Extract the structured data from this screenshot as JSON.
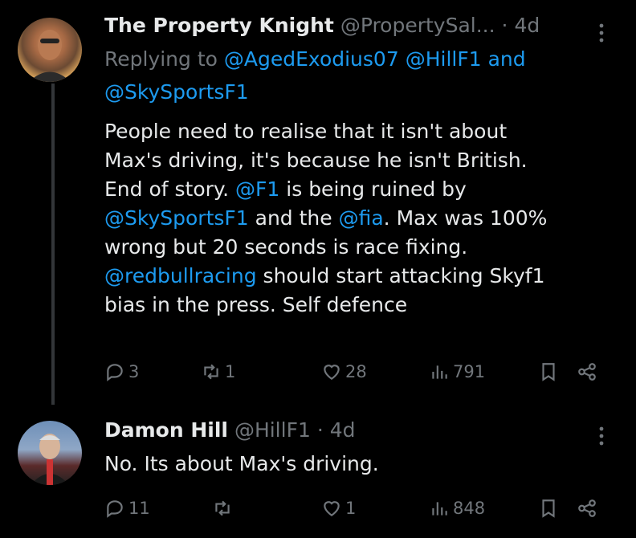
{
  "tweets": [
    {
      "display_name": "The Property Knight",
      "handle": "@PropertySal...",
      "separator": "·",
      "time": "4d",
      "replying_label": "Replying to",
      "reply_to_1": "@AgedExodius07",
      "reply_to_2": "@HillF1",
      "reply_and": "and",
      "reply_to_3": "@SkySportsF1",
      "body_parts": {
        "p1": "People need to realise that it isn't about",
        "p2": "Max's driving, it's because he isn't British.",
        "p3": "End of story. ",
        "m1": "@F1",
        "p4": " is being ruined by",
        "m2": "@SkySportsF1",
        "p5": " and the ",
        "m3": "@fia",
        "p6": ". Max was 100%",
        "p7": "wrong but 20 seconds is race fixing.",
        "m4": "@redbullracing",
        "p8": " should start attacking Skyf1",
        "p9": "bias in the press. Self defence"
      },
      "replies": "3",
      "reposts": "1",
      "likes": "28",
      "views": "791"
    },
    {
      "display_name": "Damon Hill",
      "handle": "@HillF1",
      "separator": "·",
      "time": "4d",
      "body": "No. Its about Max's driving.",
      "replies": "11",
      "reposts": "",
      "likes": "1",
      "views": "848"
    }
  ],
  "icons": [
    "reply-icon",
    "repost-icon",
    "like-icon",
    "views-icon",
    "bookmark-icon",
    "share-icon",
    "more-icon"
  ],
  "colors": {
    "background": "#000000",
    "text": "#e7e9ea",
    "muted": "#71767b",
    "link": "#1d9bf0"
  }
}
